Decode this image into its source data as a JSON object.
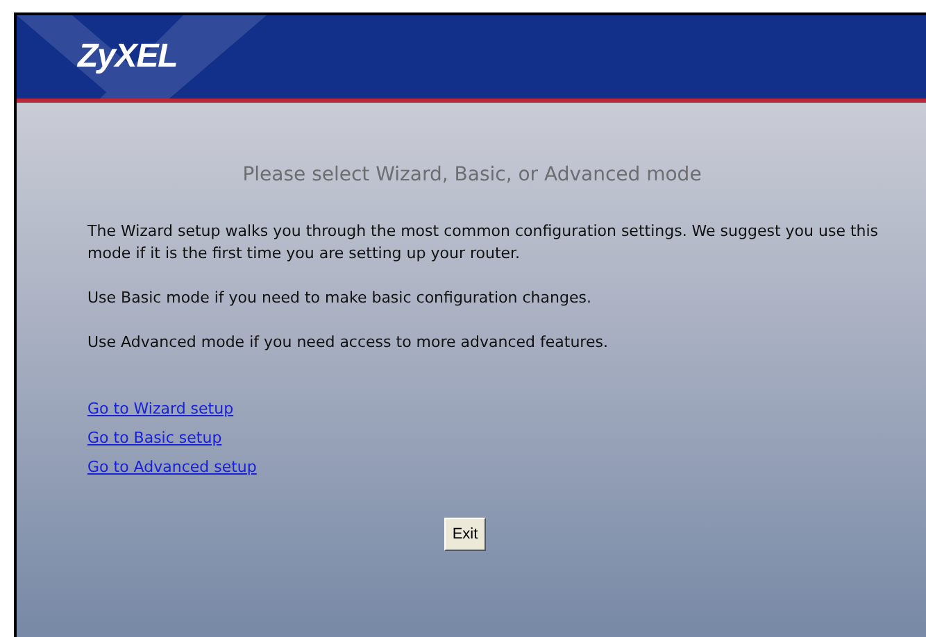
{
  "logo": "ZyXEL",
  "heading": "Please select Wizard, Basic, or Advanced mode",
  "paragraphs": [
    "The Wizard setup walks you through the most common configuration settings. We suggest you use this mode if it is the first time you are setting up your router.",
    "Use Basic mode if you need to make basic configuration changes.",
    "Use Advanced mode if you need access to more advanced features."
  ],
  "links": [
    "Go to Wizard setup",
    "Go to Basic setup",
    "Go to Advanced setup"
  ],
  "buttons": [
    "Exit"
  ]
}
